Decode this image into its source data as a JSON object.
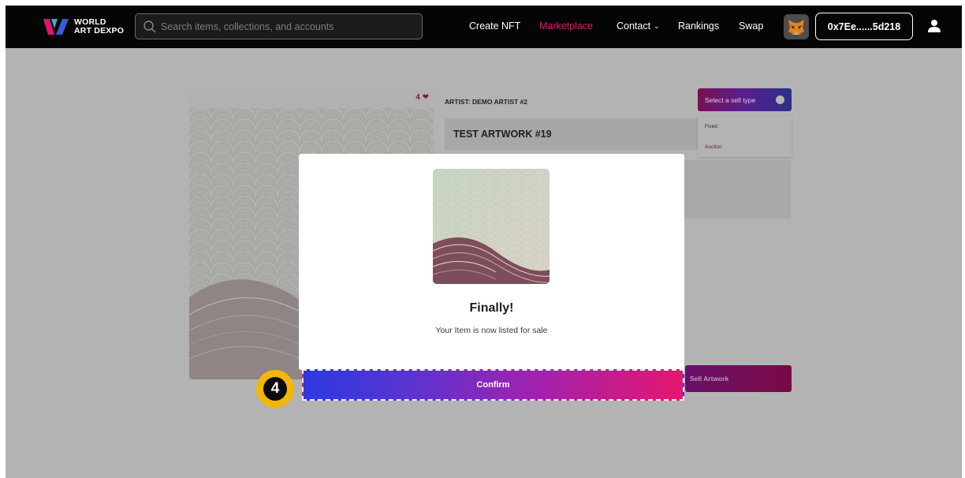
{
  "brand": {
    "name_line1": "WORLD",
    "name_line2": "ART DEXPO",
    "colors": {
      "accent": "#e3136f",
      "header_bg": "#050505",
      "badge": "#f5b707"
    }
  },
  "search": {
    "placeholder": "Search items, collections, and accounts",
    "value": ""
  },
  "nav": {
    "items": [
      {
        "label": "Create NFT",
        "active": false
      },
      {
        "label": "Marketplace",
        "active": true
      },
      {
        "label": "Contact",
        "active": false,
        "dropdown": true
      },
      {
        "label": "Rankings",
        "active": false
      },
      {
        "label": "Swap",
        "active": false
      }
    ]
  },
  "wallet": {
    "icon": "metamask-fox-icon",
    "address": "0x7Ee......5d218"
  },
  "user": {
    "icon": "user-icon"
  },
  "artwork": {
    "likes": "4",
    "artist": "ARTIST: DEMO ARTIST #2",
    "title": "TEST ARTWORK #19"
  },
  "sell": {
    "select_label": "Select a sell type",
    "options": [
      "Fixed",
      "Auction"
    ],
    "button_label": "Sell Artwork"
  },
  "modal": {
    "title": "Finally!",
    "subtitle": "Your Item is now listed for sale",
    "confirm_label": "Confirm"
  },
  "step": {
    "number": "4"
  }
}
